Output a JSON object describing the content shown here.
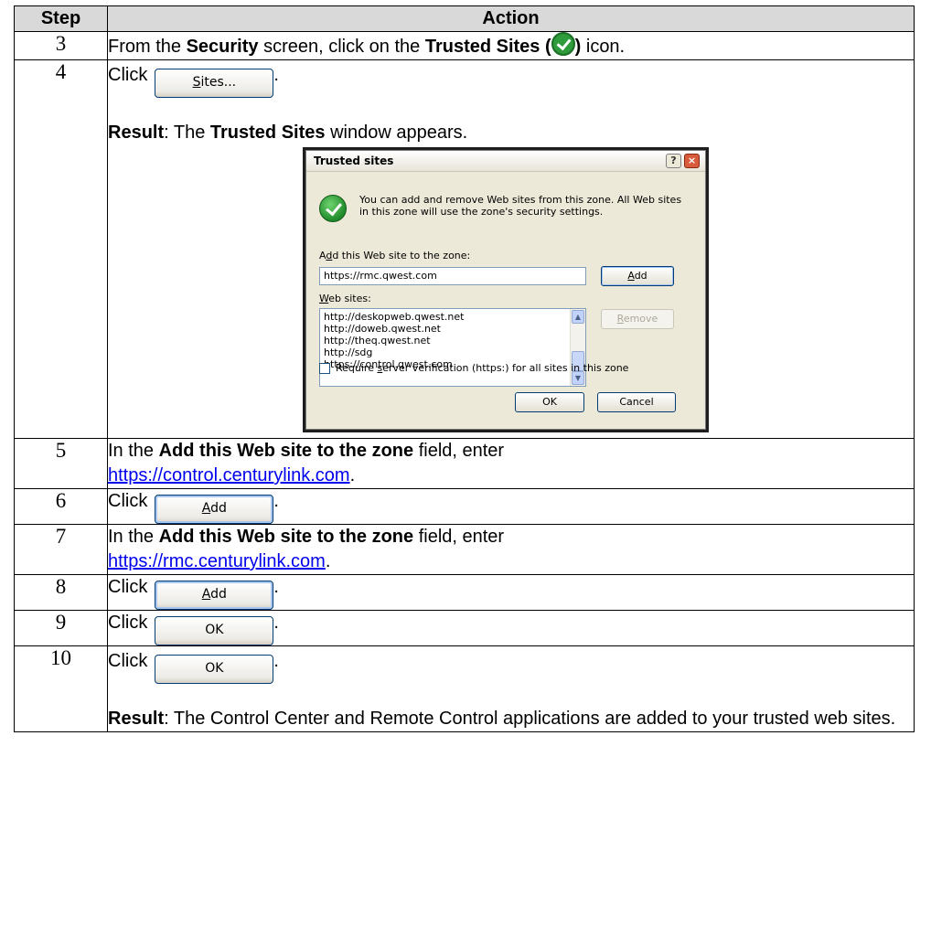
{
  "header": {
    "step": "Step",
    "action": "Action"
  },
  "rows": [
    {
      "step": "3",
      "pre": "From the ",
      "b1": "Security",
      "mid": " screen, click on the ",
      "b2": "Trusted Sites (",
      "b3": ")",
      "post": " icon."
    },
    {
      "step": "4",
      "click": "Click",
      "button_pre": "",
      "button_u": "S",
      "button_post": "ites...",
      "end": ".",
      "result_label": "Result",
      "result_pre": ":  The ",
      "result_bold": "Trusted Sites",
      "result_post": " window appears."
    },
    {
      "step": "5",
      "pre": "In the ",
      "bold": "Add this Web site to the zone",
      "post": " field, enter",
      "link": "https://control.centurylink.com",
      "end": "."
    },
    {
      "step": "6",
      "click": "Click",
      "button_u": "A",
      "button_post": "dd",
      "end": "."
    },
    {
      "step": "7",
      "pre": "In the ",
      "bold": "Add this Web site to the zone",
      "post": " field, enter",
      "link": "https://rmc.centurylink.com",
      "end": "."
    },
    {
      "step": "8",
      "click": "Click",
      "button_u": "A",
      "button_post": "dd",
      "end": "."
    },
    {
      "step": "9",
      "click": "Click",
      "button": "OK",
      "end": "."
    },
    {
      "step": "10",
      "click": "Click",
      "button": "OK",
      "end": ".",
      "result_label": "Result",
      "result_text": ":  The Control Center and Remote Control applications are added to your trusted web sites."
    }
  ],
  "dialog": {
    "title": "Trusted sites",
    "help": "?",
    "close": "×",
    "message": "You can add and remove Web sites from this zone. All Web sites in this zone will use the zone's security settings.",
    "add_label_u": "d",
    "add_label_pre": "A",
    "add_label_post": "d this Web site to the zone:",
    "add_value": "https://rmc.qwest.com",
    "add_button_u": "A",
    "add_button_post": "dd",
    "sites_label_u": "W",
    "sites_label_post": "eb sites:",
    "sites": [
      "http://deskopweb.qwest.net",
      "http://doweb.qwest.net",
      "http://theq.qwest.net",
      "http://sdg",
      "https://control.qwest.com"
    ],
    "remove_u": "R",
    "remove_post": "emove",
    "require_pre": "Require ",
    "require_u": "s",
    "require_post": "erver verification (https:) for all sites in this zone",
    "ok": "OK",
    "cancel": "Cancel",
    "icon": "green-check-icon"
  }
}
